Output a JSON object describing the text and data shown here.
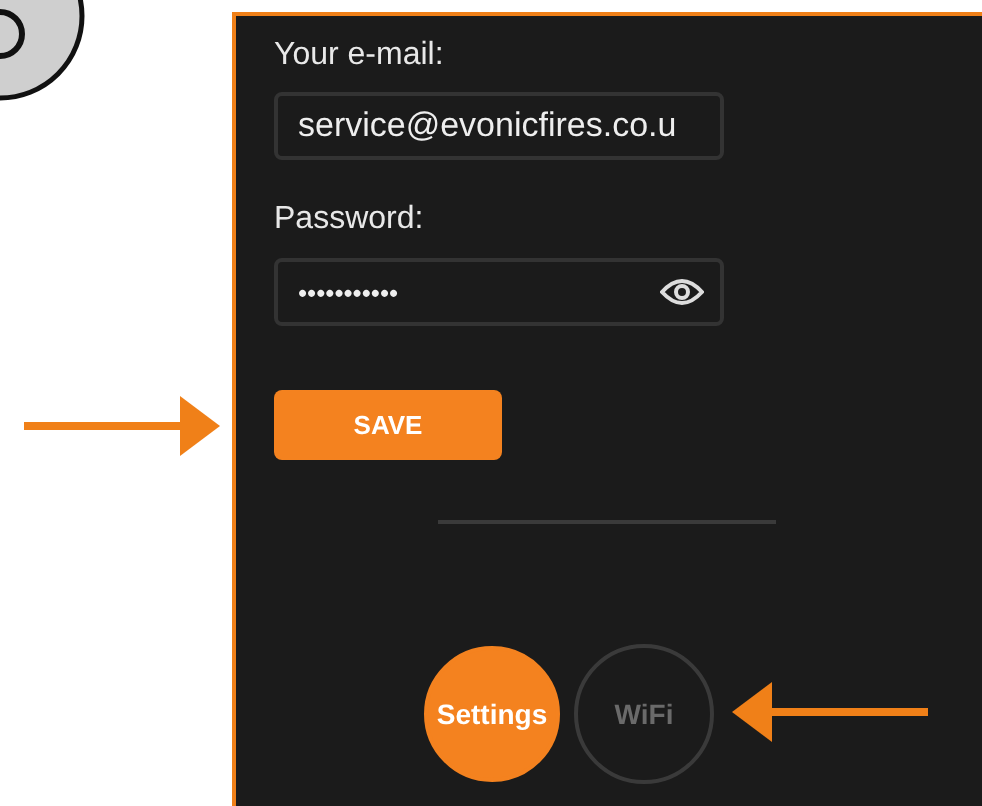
{
  "form": {
    "email_label": "Your e-mail:",
    "email_value": "service@evonicfires.co.u",
    "password_label": "Password:",
    "password_value": "•••••••••••",
    "save_button": "SAVE"
  },
  "nav": [
    {
      "label": "Settings",
      "selected": true
    },
    {
      "label": "WiFi",
      "selected": false
    }
  ]
}
